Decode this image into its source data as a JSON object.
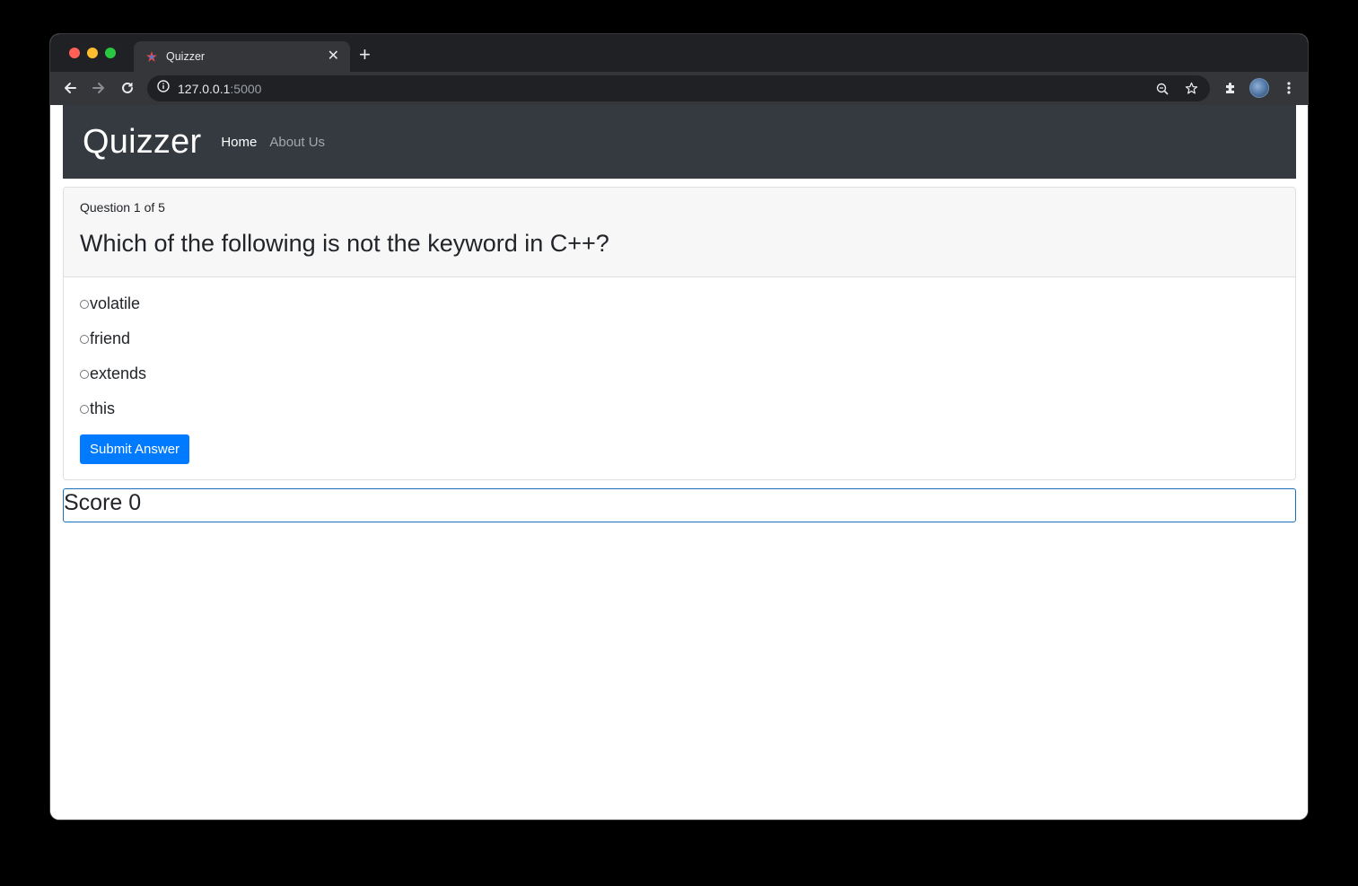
{
  "browser": {
    "tab_title": "Quizzer",
    "tab_close": "✕",
    "new_tab": "+",
    "url_host": "127.0.0.1",
    "url_port": ":5000"
  },
  "navbar": {
    "brand": "Quizzer",
    "links": [
      "Home",
      "About Us"
    ]
  },
  "quiz": {
    "counter": "Question 1 of 5",
    "question": "Which of the following is not the keyword in C++?",
    "options": [
      "volatile",
      "friend",
      "extends",
      "this"
    ],
    "submit_label": "Submit Answer"
  },
  "score": {
    "text": "Score 0"
  },
  "colors": {
    "navbar_bg": "#343a40",
    "primary": "#007bff",
    "score_border": "#1a6fb8"
  }
}
